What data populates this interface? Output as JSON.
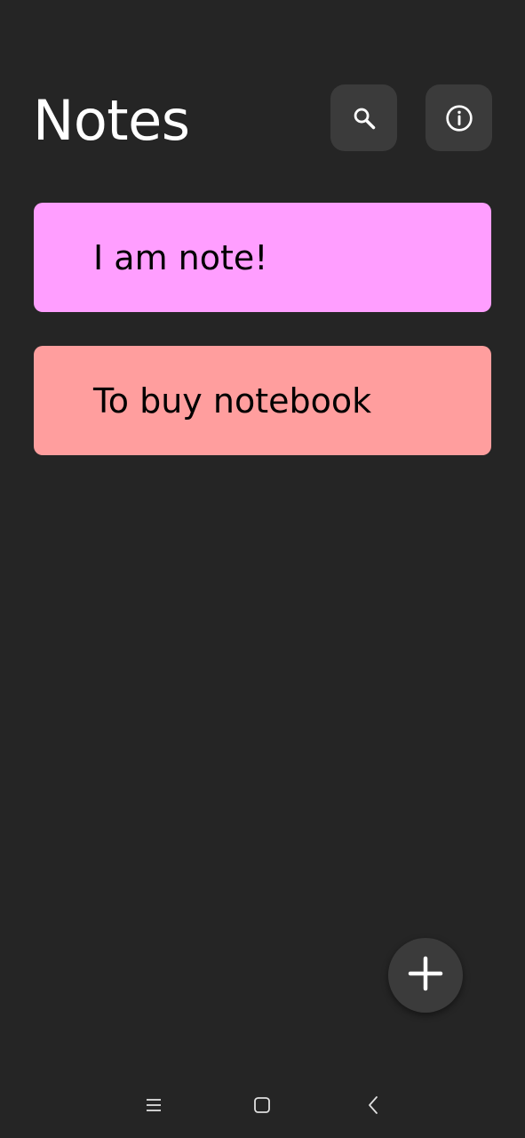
{
  "header": {
    "title": "Notes",
    "search_icon": "search-icon",
    "info_icon": "info-icon"
  },
  "notes": [
    {
      "text": "I am note!",
      "color": "#FF9EFF"
    },
    {
      "text": "To buy notebook",
      "color": "#FF9E9E"
    }
  ],
  "fab": {
    "icon": "plus-icon"
  },
  "system_nav": {
    "menu_icon": "menu-icon",
    "home_icon": "home-icon",
    "back_icon": "back-icon"
  },
  "colors": {
    "background": "#252525",
    "button": "#3B3B3B",
    "text": "#FFFFFF"
  }
}
